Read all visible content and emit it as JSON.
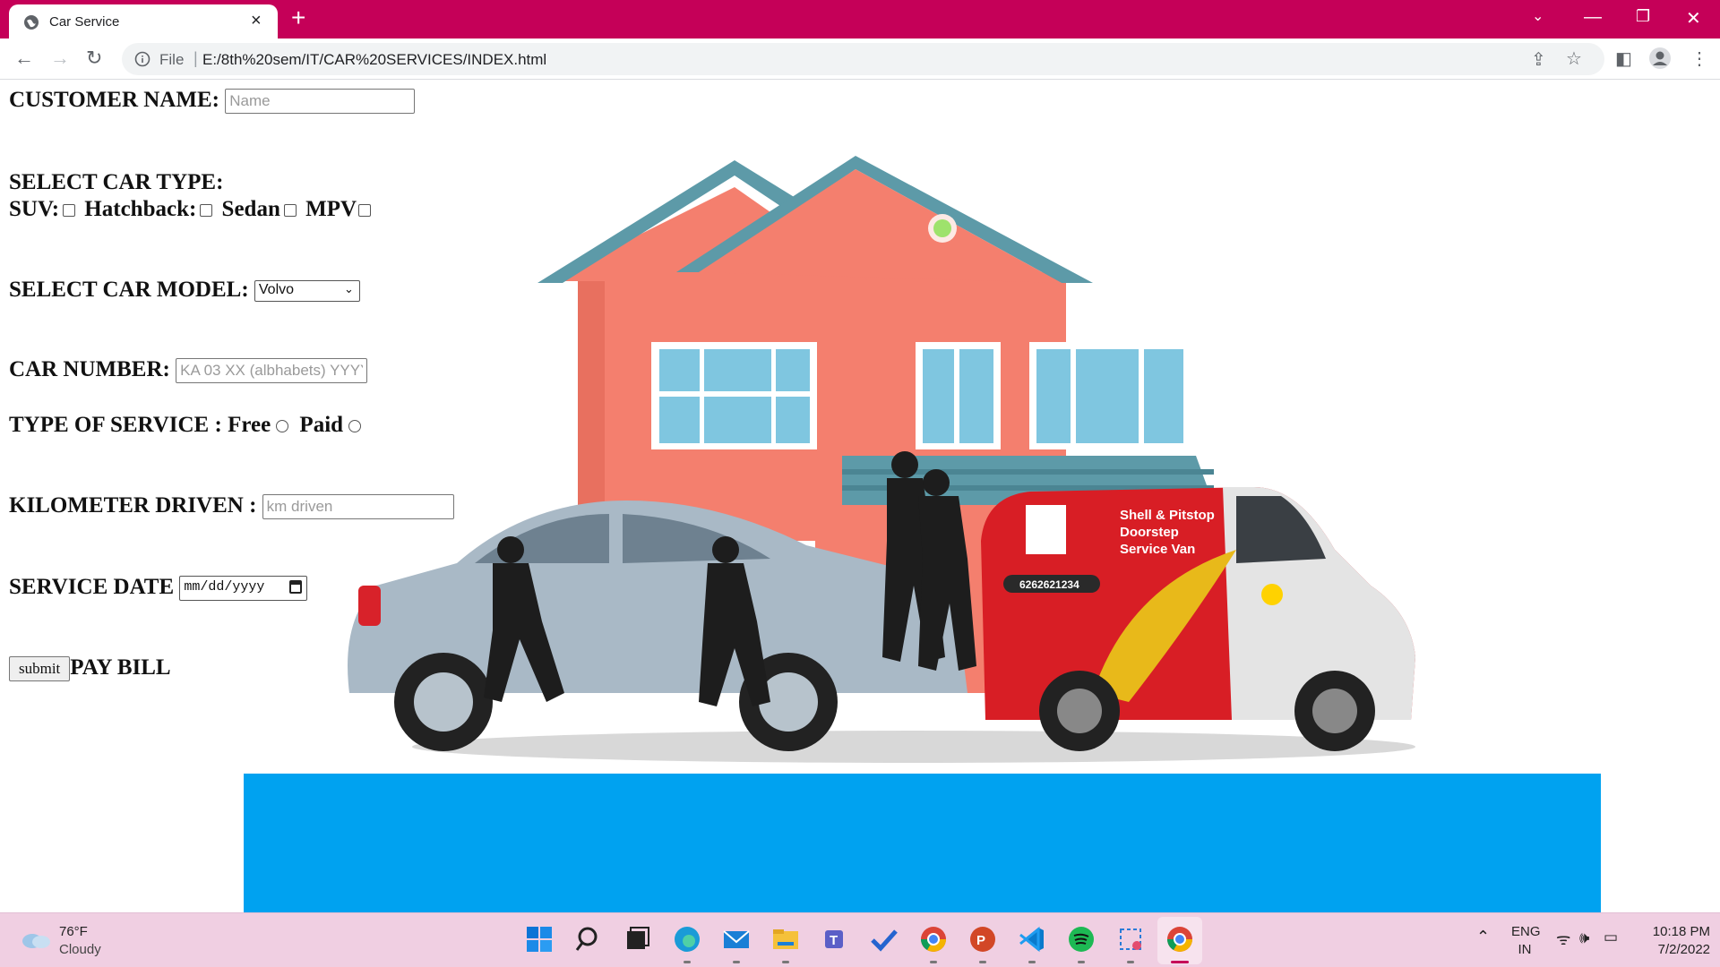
{
  "browser": {
    "tab_title": "Car Service",
    "new_tab": "+",
    "url_scheme": "File",
    "url": "E:/8th%20sem/IT/CAR%20SERVICES/INDEX.html"
  },
  "form": {
    "customer_name_label": "CUSTOMER NAME:",
    "customer_name_placeholder": "Name",
    "car_type_label": "SELECT CAR TYPE:",
    "car_types": [
      "SUV:",
      "Hatchback:",
      "Sedan",
      "MPV"
    ],
    "car_model_label": "SELECT CAR MODEL:",
    "car_model_selected": "Volvo",
    "car_number_label": "CAR NUMBER:",
    "car_number_placeholder": "KA 03 XX (albhabets) YYYY",
    "service_type_label": "TYPE OF SERVICE :",
    "service_free": "Free",
    "service_paid": "Paid",
    "km_label": "KILOMETER DRIVEN :",
    "km_placeholder": "km driven",
    "service_date_label": "SERVICE DATE",
    "service_date_placeholder": "mm/dd/yyyy",
    "submit_label": "submit",
    "pay_bill": "PAY BILL"
  },
  "hero": {
    "van_line1": "Shell & Pitstop",
    "van_line2": "Doorstep",
    "van_line3": "Service Van",
    "van_phone": "6262621234"
  },
  "taskbar": {
    "weather_temp": "76°F",
    "weather_desc": "Cloudy",
    "lang_line1": "ENG",
    "lang_line2": "IN",
    "time": "10:18 PM",
    "date": "7/2/2022"
  },
  "colors": {
    "tabbar": "#c50058",
    "banner": "#00a2f0",
    "taskbar": "#f0cfe2"
  }
}
